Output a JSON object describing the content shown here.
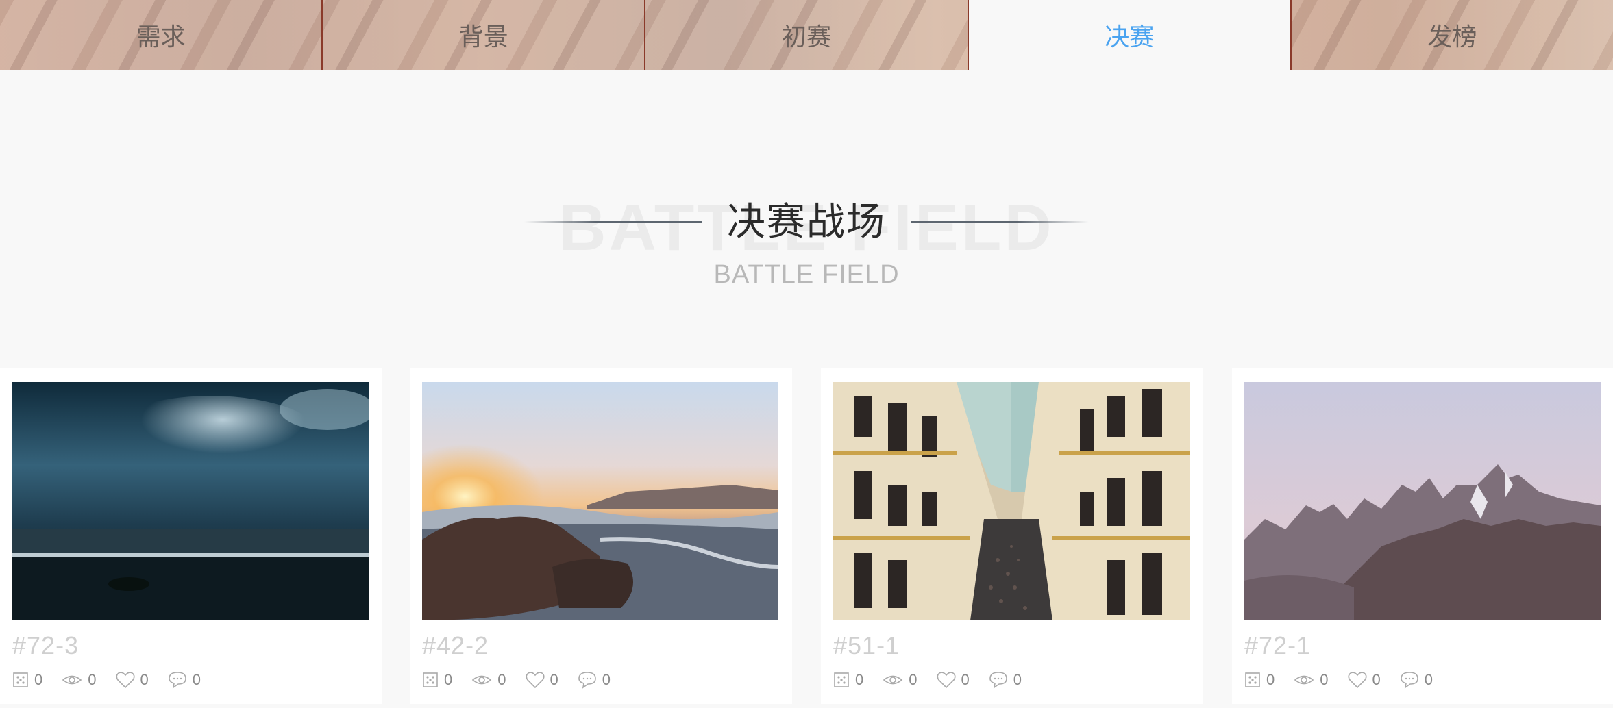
{
  "tabs": [
    {
      "label": "需求",
      "active": false
    },
    {
      "label": "背景",
      "active": false
    },
    {
      "label": "初赛",
      "active": false
    },
    {
      "label": "决赛",
      "active": true
    },
    {
      "label": "发榜",
      "active": false
    }
  ],
  "colors": {
    "active_tab": "#4aa3f0",
    "page_bg": "#f8f8f8"
  },
  "section": {
    "watermark": "BATTLE FIELD",
    "title": "决赛战场",
    "subtitle": "BATTLE FIELD"
  },
  "cards": [
    {
      "id": "#72-3",
      "photo": "stormy-sea-photo",
      "stats": {
        "votes": "0",
        "views": "0",
        "likes": "0",
        "comments": "0"
      }
    },
    {
      "id": "#42-2",
      "photo": "sunset-waves-photo",
      "stats": {
        "votes": "0",
        "views": "0",
        "likes": "0",
        "comments": "0"
      }
    },
    {
      "id": "#51-1",
      "photo": "city-street-photo",
      "stats": {
        "votes": "0",
        "views": "0",
        "likes": "0",
        "comments": "0"
      }
    },
    {
      "id": "#72-1",
      "photo": "mountain-peaks-photo",
      "stats": {
        "votes": "0",
        "views": "0",
        "likes": "0",
        "comments": "0"
      }
    }
  ],
  "icons": [
    "dice-icon",
    "eye-icon",
    "heart-icon",
    "comment-icon"
  ]
}
